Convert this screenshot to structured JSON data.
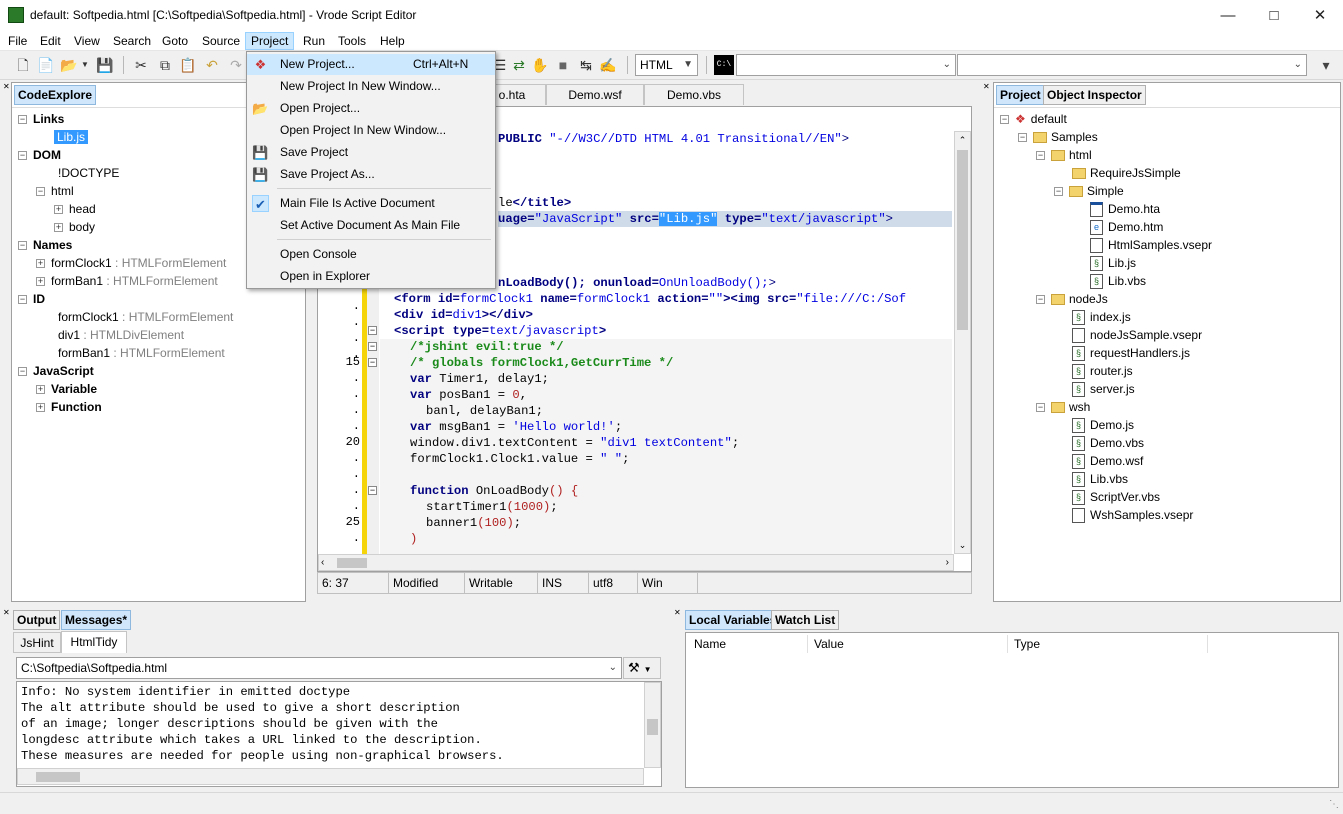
{
  "window": {
    "title": "default: Softpedia.html [C:\\Softpedia\\Softpedia.html] - Vrode Script Editor"
  },
  "menu": [
    "File",
    "Edit",
    "View",
    "Search",
    "Goto",
    "Source",
    "Project",
    "Run",
    "Tools",
    "Help"
  ],
  "toolbar": {
    "language": "HTML",
    "console_icon": "C:\\"
  },
  "project_menu": {
    "items": [
      {
        "label": "New Project...",
        "shortcut": "Ctrl+Alt+N",
        "icon": "new-project-icon"
      },
      {
        "label": "New Project In New Window...",
        "shortcut": "",
        "icon": ""
      },
      {
        "label": "Open Project...",
        "shortcut": "",
        "icon": "open-project-icon"
      },
      {
        "label": "Open Project In New Window...",
        "shortcut": "",
        "icon": ""
      },
      {
        "label": "Save Project",
        "shortcut": "",
        "icon": "save-project-icon"
      },
      {
        "label": "Save Project As...",
        "shortcut": "",
        "icon": "save-project-as-icon"
      },
      {
        "label": "Main File Is Active Document",
        "shortcut": "",
        "icon": "checkmark-icon"
      },
      {
        "label": "Set Active Document As Main File",
        "shortcut": "",
        "icon": ""
      },
      {
        "label": "Open Console",
        "shortcut": "",
        "icon": ""
      },
      {
        "label": "Open in Explorer",
        "shortcut": "",
        "icon": ""
      }
    ]
  },
  "code_explore": {
    "tab": "CodeExplore",
    "rows": [
      {
        "label": "Links",
        "type": ""
      },
      {
        "label": "Lib.js",
        "type": ""
      },
      {
        "label": "DOM",
        "type": ""
      },
      {
        "label": "!DOCTYPE",
        "type": ""
      },
      {
        "label": "html",
        "type": ""
      },
      {
        "label": "head",
        "type": ""
      },
      {
        "label": "body",
        "type": ""
      },
      {
        "label": "Names",
        "type": ""
      },
      {
        "label": "formClock1",
        "type": " : HTMLFormElement"
      },
      {
        "label": "formBan1",
        "type": " : HTMLFormElement"
      },
      {
        "label": "ID",
        "type": ""
      },
      {
        "label": "formClock1",
        "type": " : HTMLFormElement"
      },
      {
        "label": "div1",
        "type": " : HTMLDivElement"
      },
      {
        "label": "formBan1",
        "type": " : HTMLFormElement"
      },
      {
        "label": "JavaScript",
        "type": ""
      },
      {
        "label": "Variable",
        "type": ""
      },
      {
        "label": "Function",
        "type": ""
      }
    ]
  },
  "editor": {
    "tabs": [
      "o.hta",
      "Demo.wsf",
      "Demo.vbs"
    ],
    "line_numbers": {
      "l11": ".",
      "l12": ".",
      "l13": ".",
      "l14": ".",
      "l15": "15",
      "l16": ".",
      "l17": ".",
      "l18": ".",
      "l19": ".",
      "l20": "20",
      "l21": ".",
      "l22": ".",
      "l23": ".",
      "l24": ".",
      "l25": "25",
      "l26": "."
    },
    "lines": {
      "l1a": "PUBLIC ",
      "l1b": "\"-//W3C//DTD HTML 4.01 Transitional//EN\"",
      "l1c": ">",
      "l4a": "le",
      "l4b": "</title>",
      "l5a": "uage=",
      "l5b": "\"JavaScript\"",
      "l5c": " src=",
      "l5d": "\"Lib.js\"",
      "l5e": " type=",
      "l5f": "\"text/javascript\"",
      "l5g": ">",
      "l9a": "nLoadBody(); onunload=",
      "l9b": "OnUnloadBody();",
      ">": ">",
      "l10a": "<form ",
      "l10b": "id=",
      "l10c": "formClock1 ",
      "l10d": "name=",
      "l10e": "formClock1 ",
      "l10f": "action=",
      "l10g": "\"\"",
      "l10h": "><img ",
      "l10i": "src=",
      "l10j": "\"file:///C:/Sof",
      "l11a": "<div ",
      "l11b": "id=",
      "l11c": "div1",
      "l11d": "></div>",
      "l12a": "<script ",
      "l12b": "type=",
      "l12c": "text/javascript",
      "l12d": ">",
      "l13": "/*jshint evil:true */",
      "l14": "/* globals formClock1,GetCurrTime */",
      "l15a": "var ",
      "l15b": "Timer1, delay1;",
      "l16a": "var ",
      "l16b": "posBan1 = ",
      "l16c": "0",
      ",": ",",
      "l17a": "banl, delayBan1;",
      "l18a": "var ",
      "l18b": "msgBan1 = ",
      "l18c": "'Hello world!'",
      "l18d": ";",
      "l19a": "window.div1.textContent = ",
      "l19b": "\"div1 textContent\"",
      "l19c": ";",
      "l20a": "formClock1.Clock1.value = ",
      "l20b": "\" \"",
      "l20c": ";",
      "l22a": "function ",
      "l22b": "OnLoadBody",
      "l22c": "() {",
      "l23a": "startTimer1",
      "l23b": "(1000)",
      "l23c": ";",
      "l24a": "banner1",
      "l24b": "(100)",
      "l24c": ";",
      "l25": ")"
    }
  },
  "status": {
    "pos": "6: 37",
    "modified": "Modified",
    "writable": "Writable",
    "ins": "INS",
    "enc": "utf8",
    "eol": "Win"
  },
  "project_panel": {
    "tabs": [
      "Project",
      "Object Inspector"
    ],
    "tree": [
      {
        "label": "default"
      },
      {
        "label": "Samples"
      },
      {
        "label": "html"
      },
      {
        "label": "RequireJsSimple"
      },
      {
        "label": "Simple"
      },
      {
        "label": "Demo.hta"
      },
      {
        "label": "Demo.htm"
      },
      {
        "label": "HtmlSamples.vsepr"
      },
      {
        "label": "Lib.js"
      },
      {
        "label": "Lib.vbs"
      },
      {
        "label": "nodeJs"
      },
      {
        "label": "index.js"
      },
      {
        "label": "nodeJsSample.vsepr"
      },
      {
        "label": "requestHandlers.js"
      },
      {
        "label": "router.js"
      },
      {
        "label": "server.js"
      },
      {
        "label": "wsh"
      },
      {
        "label": "Demo.js"
      },
      {
        "label": "Demo.vbs"
      },
      {
        "label": "Demo.wsf"
      },
      {
        "label": "Lib.vbs"
      },
      {
        "label": "ScriptVer.vbs"
      },
      {
        "label": "WshSamples.vsepr"
      }
    ]
  },
  "output_panel": {
    "tabs": [
      "Output",
      "Messages*"
    ],
    "subtabs": [
      "JsHint",
      "HtmlTidy"
    ],
    "file": "C:\\Softpedia\\Softpedia.html",
    "messages": [
      "Info: No system identifier in emitted doctype",
      "The alt attribute should be used to give a short description",
      "of an image; longer descriptions should be given with the",
      "longdesc attribute which takes a URL linked to the description.",
      "These measures are needed for people using non-graphical browsers."
    ]
  },
  "vars_panel": {
    "tabs": [
      "Local Variables",
      "Watch List"
    ],
    "columns": [
      "Name",
      "Value",
      "Type"
    ]
  }
}
